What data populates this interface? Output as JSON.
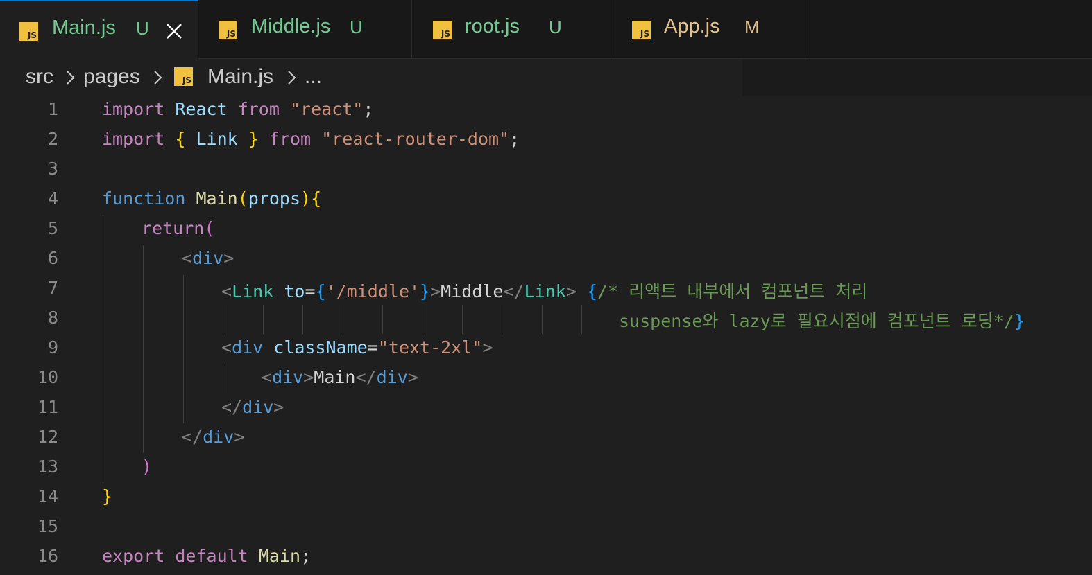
{
  "tabs": [
    {
      "name": "Main.js",
      "status": "U",
      "icon": "js-file-icon",
      "active": true
    },
    {
      "name": "Middle.js",
      "status": "U",
      "icon": "js-file-icon",
      "active": false
    },
    {
      "name": "root.js",
      "status": "U",
      "icon": "js-file-icon",
      "active": false
    },
    {
      "name": "App.js",
      "status": "M",
      "icon": "js-file-icon",
      "active": false
    }
  ],
  "icon_label": "JS",
  "breadcrumb": {
    "items": [
      "src",
      "pages",
      "Main.js",
      "..."
    ]
  },
  "colors": {
    "accent": "#0078d4",
    "untracked": "#73c991",
    "modified": "#e2c08d"
  },
  "code": {
    "l1": {
      "a": "import",
      "b": "React",
      "c": "from",
      "d": "\"react\"",
      "e": ";"
    },
    "l2": {
      "a": "import",
      "b": "{",
      "c": "Link",
      "d": "}",
      "e": "from",
      "f": "\"react-router-dom\"",
      "g": ";"
    },
    "l4": {
      "a": "function",
      "b": "Main",
      "c": "(",
      "d": "props",
      "e": ")",
      "f": "{"
    },
    "l5": {
      "a": "return",
      "b": "("
    },
    "l6": {
      "a": "<",
      "b": "div",
      "c": ">"
    },
    "l7": {
      "a": "<",
      "b": "Link",
      "c": "to",
      "d": "=",
      "e": "{",
      "f": "'/middle'",
      "g": "}",
      "h": ">",
      "i": "Middle",
      "j": "</",
      "k": "Link",
      "l": ">",
      "m": "{",
      "n": "/* 리액트 내부에서 컴포넌트 처리"
    },
    "l8": {
      "a": "suspense와 lazy로 필요시점에 컴포넌트 로딩*/",
      "b": "}"
    },
    "l9": {
      "a": "<",
      "b": "div",
      "c": "className",
      "d": "=",
      "e": "\"text-2xl\"",
      "f": ">"
    },
    "l10": {
      "a": "<",
      "b": "div",
      "c": ">",
      "d": "Main",
      "e": "</",
      "f": "div",
      "g": ">"
    },
    "l11": {
      "a": "</",
      "b": "div",
      "c": ">"
    },
    "l12": {
      "a": "</",
      "b": "div",
      "c": ">"
    },
    "l13": {
      "a": ")"
    },
    "l14": {
      "a": "}"
    },
    "l16": {
      "a": "export",
      "b": "default",
      "c": "Main",
      "d": ";"
    }
  },
  "line_numbers": [
    "1",
    "2",
    "3",
    "4",
    "5",
    "6",
    "7",
    "8",
    "9",
    "10",
    "11",
    "12",
    "13",
    "14",
    "15",
    "16"
  ]
}
